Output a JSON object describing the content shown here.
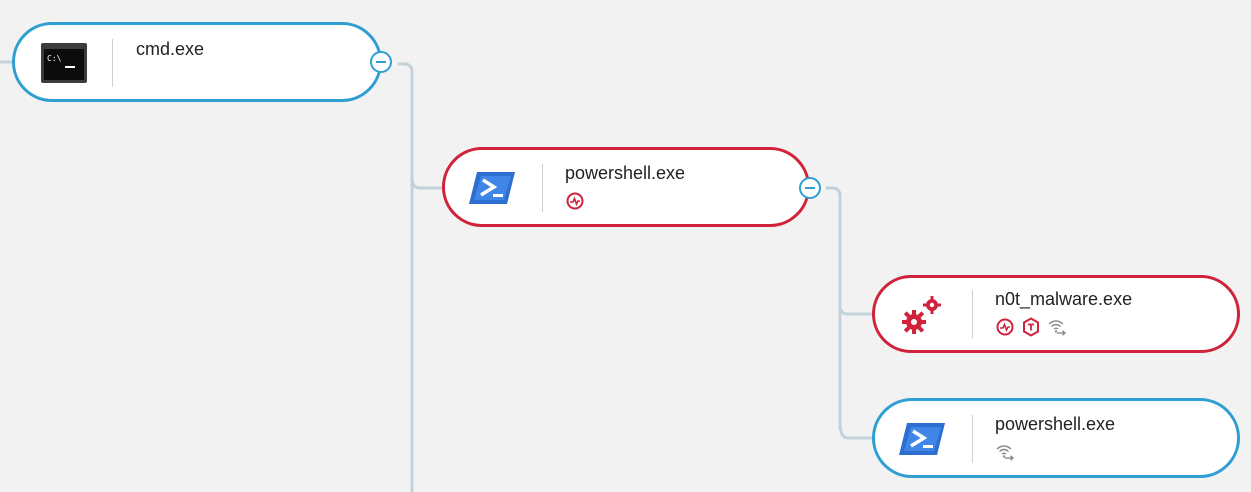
{
  "colors": {
    "normal_border": "#2f9fd2",
    "alert_border": "#d0223a",
    "connector": "#c3d2da",
    "background": "#f2f2f2"
  },
  "nodes": [
    {
      "label": "cmd.exe",
      "icon": "terminal-icon",
      "state": "normal",
      "badges": []
    },
    {
      "label": "powershell.exe",
      "icon": "powershell-icon",
      "state": "alert",
      "badges": [
        "activity-alert-icon"
      ]
    },
    {
      "label": "n0t_malware.exe",
      "icon": "gears-icon",
      "state": "alert",
      "badges": [
        "activity-alert-icon",
        "threat-shield-icon",
        "network-connection-icon"
      ]
    },
    {
      "label": "powershell.exe",
      "icon": "powershell-icon",
      "state": "normal",
      "badges": [
        "network-connection-icon"
      ]
    }
  ],
  "toggles": [
    "collapse-icon",
    "collapse-icon"
  ]
}
